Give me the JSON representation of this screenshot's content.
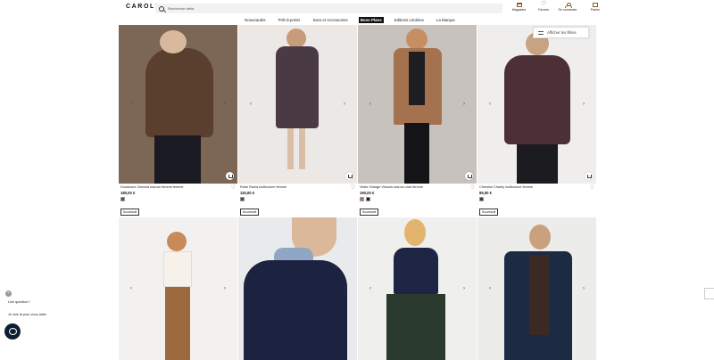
{
  "header": {
    "logo": "CAROLL",
    "search": {
      "placeholder": "Recherche",
      "value": "Recherche tabla"
    },
    "utils": [
      {
        "icon": "store-icon",
        "label": "Magasins"
      },
      {
        "icon": "heart-icon",
        "label": "Favoris"
      },
      {
        "icon": "person-icon",
        "label": "Se connecter"
      },
      {
        "icon": "bag-icon",
        "label": "Panier"
      }
    ]
  },
  "nav": {
    "items": [
      {
        "label": "Nouveautés"
      },
      {
        "label": "Prêt-à-porter"
      },
      {
        "label": "Sacs et Accessoires"
      },
      {
        "label": "Bons Plans",
        "active": true
      },
      {
        "label": "Editions Limitées"
      },
      {
        "label": "La Marque"
      }
    ]
  },
  "filters": {
    "label": "Afficher les filtres"
  },
  "products": [
    {
      "name": "Doudoune Gamma marron femme femme",
      "price": "180,00 €",
      "badge": "Nouveauté",
      "swatches": [
        "#6b4a3a"
      ],
      "bg": "#8a6a56"
    },
    {
      "name": "Robe Rania multicolore femme",
      "price": "115,00 €",
      "badge": "Nouveauté",
      "swatches": [
        "#4a4a4a"
      ],
      "bg": "#ece8e5"
    },
    {
      "name": "Veste Vintage Velours marron clair femme",
      "price": "190,00 €",
      "badge": "Nouveauté",
      "swatches": [
        "#a47a64",
        "#1b1b2a"
      ],
      "bg": "#c7c2bd"
    },
    {
      "name": "Chemise Charity multicolore femme",
      "price": "85,00 €",
      "badge": "Nouveauté",
      "swatches": [
        "#3b3b3b"
      ],
      "bg": "#f0eeed"
    },
    {
      "name": "",
      "price": "",
      "badge": "",
      "swatches": [],
      "bg": "#f3f1ef"
    },
    {
      "name": "",
      "price": "",
      "badge": "",
      "swatches": [],
      "bg": "#e9eaec"
    },
    {
      "name": "",
      "price": "",
      "badge": "",
      "swatches": [],
      "bg": "#efefee"
    },
    {
      "name": "",
      "price": "",
      "badge": "",
      "swatches": [],
      "bg": "#ececea"
    }
  ],
  "chat": {
    "question1": "Une question?",
    "question2": "Je suis là pour vous aider"
  },
  "colors": {
    "accent": "#8a5a2b",
    "chat": "#0e1e33"
  }
}
